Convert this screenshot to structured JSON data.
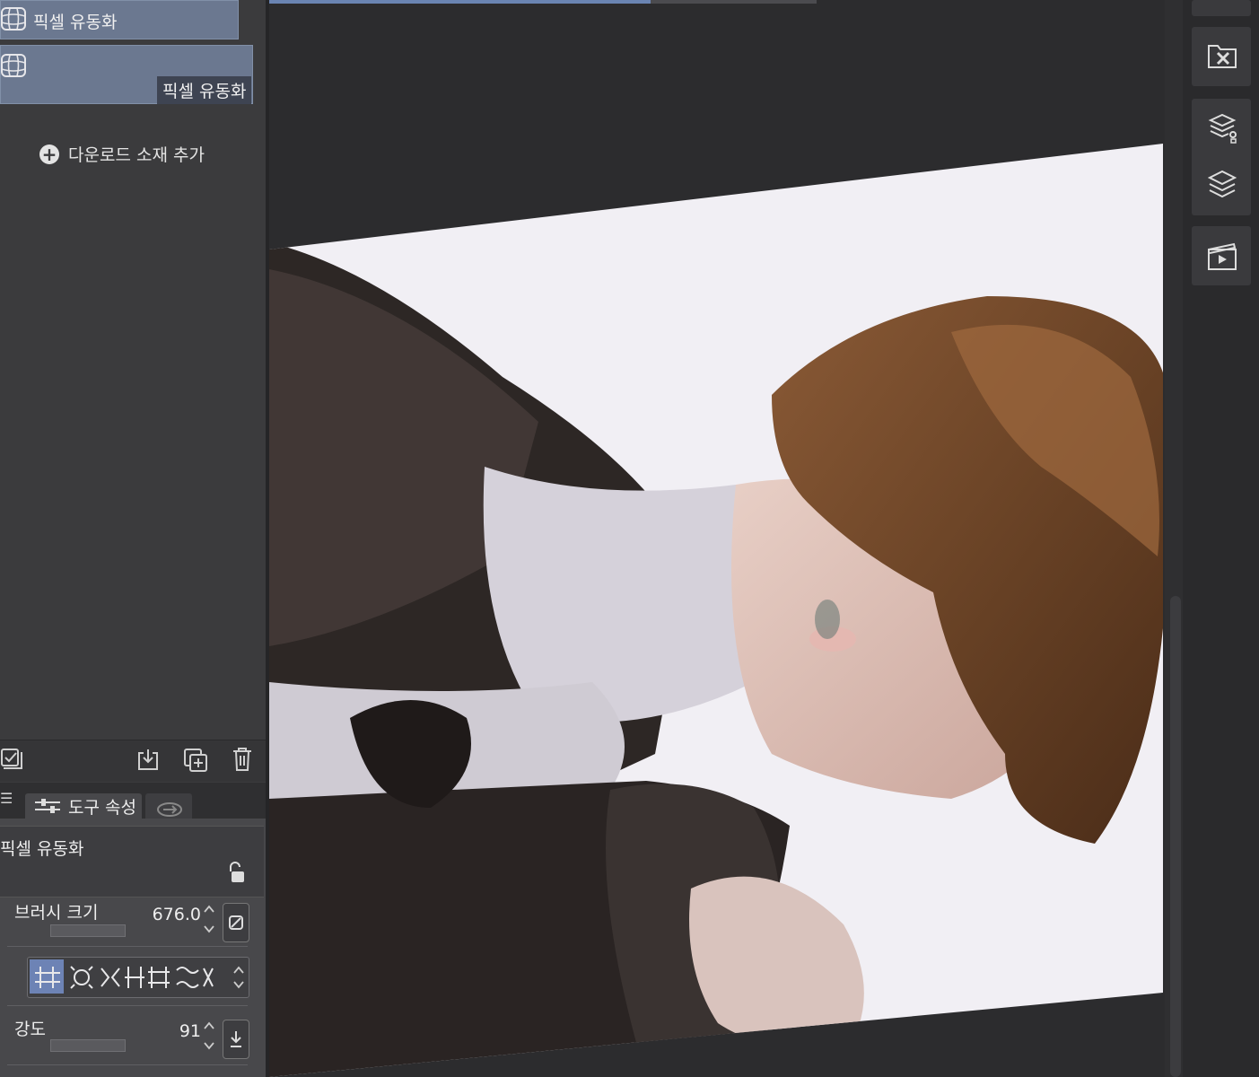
{
  "materials": {
    "item1_label": "픽셀 유동화",
    "item2_label": "픽셀 유동화",
    "add_download": "다운로드 소재 추가"
  },
  "tool_property": {
    "tab_label": "도구 속성",
    "tool_name": "픽셀 유동화",
    "brush_size_label": "브러시 크기",
    "brush_size_value": "676.0",
    "strength_label": "강도",
    "strength_value": "91"
  },
  "icons": {
    "material_icon": "liquify-grid-icon",
    "tool_strip": [
      "select-all-icon",
      "import-icon",
      "duplicate-icon",
      "trash-icon"
    ],
    "right_bar": [
      "material-folder-icon",
      "layer-property-icon",
      "layers-icon",
      "animation-icon"
    ]
  },
  "colors": {
    "panel_bg": "#3b3b3d",
    "selected_item": "#6b7890",
    "accent": "#6d83b5",
    "canvas_bg": "#2c2c2e"
  }
}
